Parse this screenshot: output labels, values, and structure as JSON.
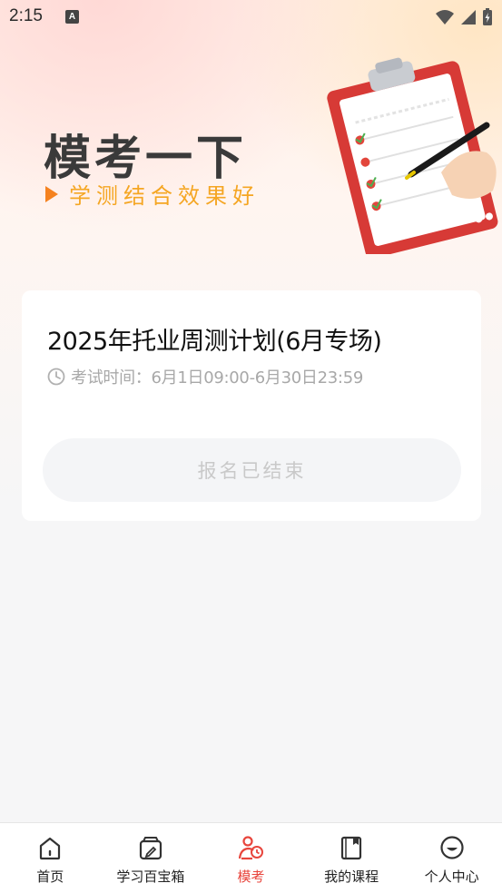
{
  "status_bar": {
    "time": "2:15",
    "notification_letter": "A"
  },
  "hero": {
    "title": "模考一下",
    "subtitle": "学测结合效果好"
  },
  "exam_card": {
    "title": "2025年托业周测计划(6月专场)",
    "time_text": "考试时间：6月1日09:00-6月30日23:59",
    "button_label": "报名已结束"
  },
  "nav": {
    "items": [
      {
        "label": "首页",
        "icon": "home-icon",
        "active": false
      },
      {
        "label": "学习百宝箱",
        "icon": "toolbox-icon",
        "active": false
      },
      {
        "label": "模考",
        "icon": "exam-icon",
        "active": true
      },
      {
        "label": "我的课程",
        "icon": "course-icon",
        "active": false
      },
      {
        "label": "个人中心",
        "icon": "profile-icon",
        "active": false
      }
    ]
  },
  "colors": {
    "accent": "#e8453c",
    "subtitle": "#f5a623",
    "disabled_text": "#c9c9c9"
  }
}
